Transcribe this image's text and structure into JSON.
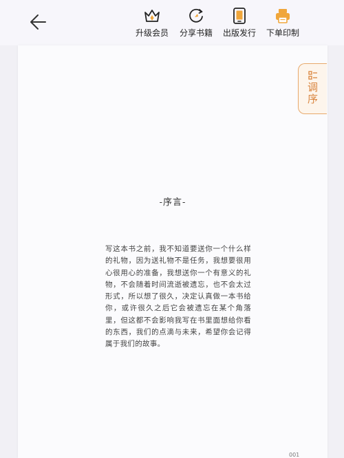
{
  "toolbar": {
    "back_label": "",
    "items": [
      {
        "id": "upgrade",
        "label": "升级会员",
        "icon": "crown-icon",
        "color": "#f0a63a"
      },
      {
        "id": "share",
        "label": "分享书籍",
        "icon": "share-refresh-icon",
        "color": "#f0a63a"
      },
      {
        "id": "publish",
        "label": "出版发行",
        "icon": "phone-book-icon",
        "color": "#f0a63a"
      },
      {
        "id": "print",
        "label": "下单印制",
        "icon": "printer-icon",
        "color": "#f0a63a"
      }
    ]
  },
  "side_tab": {
    "label": "调序",
    "icon": "list-reorder-icon",
    "color": "#d9843d"
  },
  "page": {
    "chapter_title": "-序言-",
    "body": "写这本书之前，我不知道要送你一个什么样的礼物，因为送礼物不是任务，我想要很用心很用心的准备，我想送你一个有意义的礼物，不会随着时间流逝被遗忘，也不会太过形式，所以想了很久，决定认真做一本书给你，或许很久之后它会被遗忘在某个角落里，但这都不会影响我写在书里面想给你看的东西，我们的点滴与未来，希望你会记得属于我们的故事。",
    "page_number": "001"
  }
}
